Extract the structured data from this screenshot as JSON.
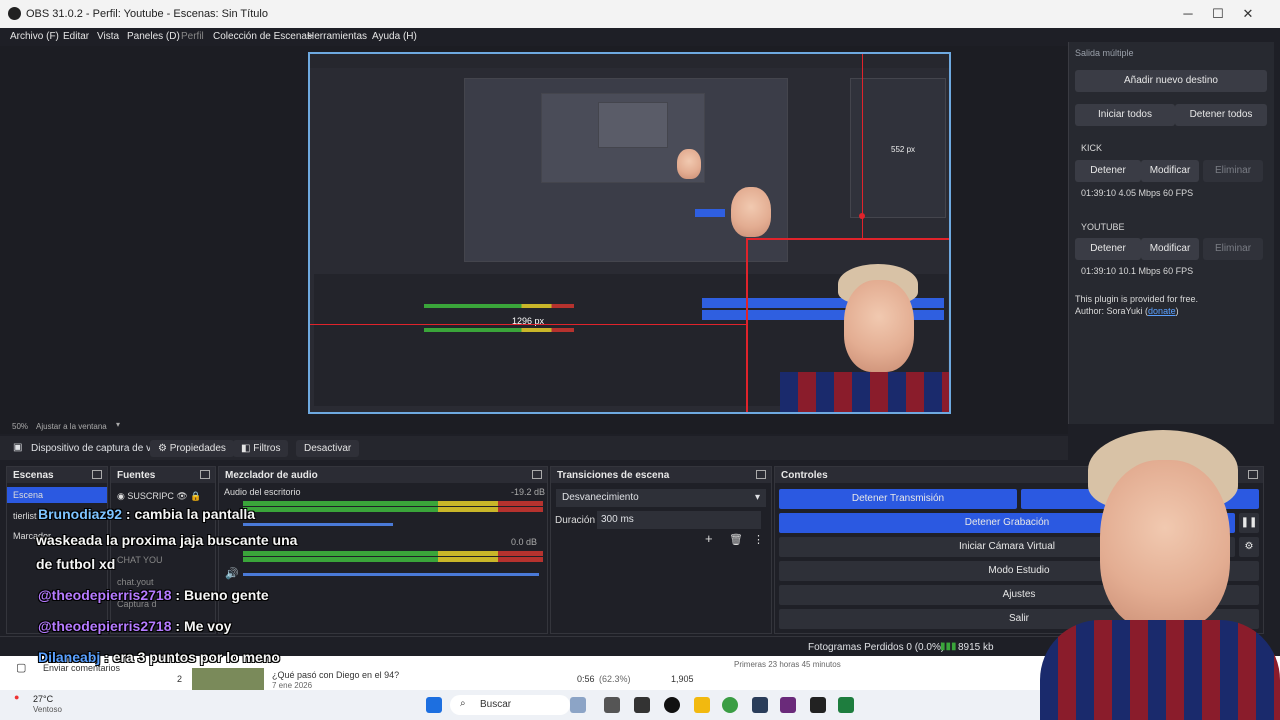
{
  "window": {
    "title": "OBS 31.0.2 - Perfil: Youtube - Escenas: Sin Título",
    "controls": [
      "─",
      "☐",
      "✕"
    ]
  },
  "menu": [
    "Archivo (F)",
    "Editar",
    "Vista",
    "Paneles (D)",
    "Perfil",
    "Colección de Escenas",
    "Herramientas",
    "Ayuda (H)"
  ],
  "preview": {
    "zoom": "50%",
    "fit_label": "Ajustar a la ventana",
    "measure_1": "552 px",
    "measure_2": "1296 px"
  },
  "source_toolbar": {
    "source_name": "Dispositivo de captura de v",
    "properties": "Propiedades",
    "filters": "Filtros",
    "deactivate": "Desactivar"
  },
  "scenes": {
    "title": "Escenas",
    "items": [
      "Escena",
      "tierlist",
      "Marcador"
    ]
  },
  "sources": {
    "title": "Fuentes",
    "items": [
      "SUSCRIPC",
      "CHAT YOU",
      "chat.yout",
      "Captura d"
    ]
  },
  "mixer": {
    "title": "Mezclador de audio",
    "channel_1": "Audio del escritorio",
    "channel_1_db": "-19.2 dB",
    "channel_2_db": "0.0 dB",
    "scale": [
      "-60",
      "-55",
      "-50",
      "-45",
      "-40",
      "-35",
      "-30",
      "-25",
      "-20",
      "-15",
      "-10",
      "-5",
      "0"
    ]
  },
  "transitions": {
    "title": "Transiciones de escena",
    "selected": "Desvanecimiento",
    "duration_label": "Duración",
    "duration_value": "300 ms"
  },
  "controls": {
    "title": "Controles",
    "stop_stream": "Detener Transmisión",
    "stop_record": "Detener Grabación",
    "virtual_cam": "Iniciar Cámara Virtual",
    "studio_mode": "Modo Estudio",
    "settings": "Ajustes",
    "exit": "Salir"
  },
  "status": {
    "dropped": "Fotogramas Perdidos 0 (0.0%)",
    "bitrate": "8915 kb"
  },
  "multi_output": {
    "title": "Salida múltiple",
    "add_target": "Añadir nuevo destino",
    "start_all": "Iniciar todos",
    "stop_all": "Detener todos",
    "targets": [
      {
        "name": "KICK",
        "stop": "Detener",
        "edit": "Modificar",
        "delete": "Eliminar",
        "stats": "01:39:10  4.05 Mbps  60 FPS"
      },
      {
        "name": "YOUTUBE",
        "stop": "Detener",
        "edit": "Modificar",
        "delete": "Eliminar",
        "stats": "01:39:10  10.1 Mbps  60 FPS"
      }
    ],
    "plugin_note": "This plugin is provided for free.",
    "author_prefix": "Author: SoraYuki (",
    "author_link": "donate",
    "author_suffix": ")"
  },
  "chat": [
    {
      "user": "Brunodiaz92",
      "msg": " : cambia la pantalla"
    },
    {
      "user": "",
      "msg": "waskeada la proxima jaja buscante una"
    },
    {
      "user": "",
      "msg": "de futbol xd"
    },
    {
      "user": "@theodepierris2718",
      "msg": " : Bueno gente"
    },
    {
      "user": "@theodepierris2718",
      "msg": " : Me voy"
    },
    {
      "user": "Dilaneabj",
      "msg": " : era 3 puntos por lo meno"
    }
  ],
  "webpage": {
    "feedback": "Enviar comentarios",
    "row_num": "2",
    "video_title": "¿Qué pasó con Diego en el 94?",
    "video_date": "7 ene 2026",
    "duration": "0:56",
    "percent": "(62.3%)",
    "views": "1,905",
    "first_hours": "Primeras 23 horas 45 minutos"
  },
  "taskbar": {
    "temp": "27°C",
    "weather": "Ventoso",
    "search": "Buscar"
  },
  "colors": {
    "accent_blue": "#2b59e1",
    "selection_red": "#e0232b",
    "panel_bg": "#1f2027"
  }
}
